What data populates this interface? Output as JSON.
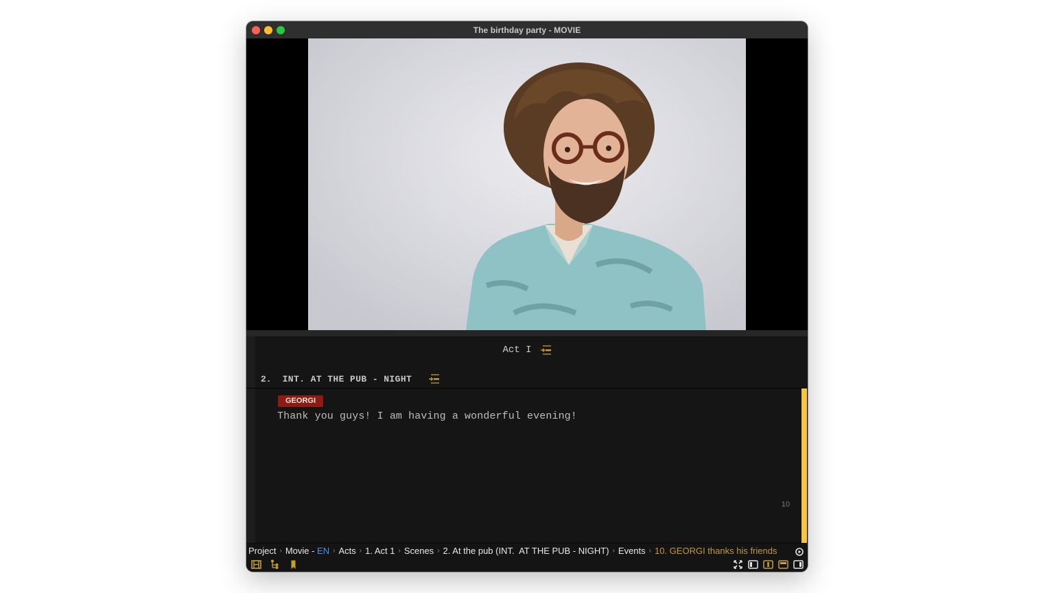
{
  "window": {
    "title": "The birthday party - MOVIE"
  },
  "video": {
    "content": "portrait photo of a smiling man with curly hair, round tortoiseshell glasses and a floral teal shirt"
  },
  "script": {
    "act_title": "Act I",
    "scene": {
      "number": "2.",
      "heading": "INT. AT THE PUB - NIGHT"
    },
    "event": {
      "character": "GEORGI",
      "dialogue": "Thank you guys! I am having a wonderful evening!",
      "number": "10"
    }
  },
  "breadcrumb": {
    "items": [
      {
        "label": "Project"
      },
      {
        "label": "Movie - ",
        "lang": "EN"
      },
      {
        "label": "Acts"
      },
      {
        "label": "1. Act 1"
      },
      {
        "label": "Scenes"
      },
      {
        "label": "2. At the pub (INT.  AT THE PUB - NIGHT)"
      },
      {
        "label": "Events"
      },
      {
        "label": "10. GEORGI thanks his friends"
      }
    ],
    "separator": "›"
  },
  "toolbar": {
    "left": [
      "film-strip-icon",
      "hierarchy-tree-icon",
      "bookmark-icon"
    ],
    "right": [
      "fullscreen-icon",
      "layout-left-panel-icon",
      "layout-center-panel-icon",
      "layout-top-panel-icon",
      "layout-right-panel-icon"
    ]
  },
  "colors": {
    "accent": "#c2993b",
    "active_event": "#f7c544",
    "character_tag": "#8e1a12",
    "language": "#4a8ff0"
  }
}
